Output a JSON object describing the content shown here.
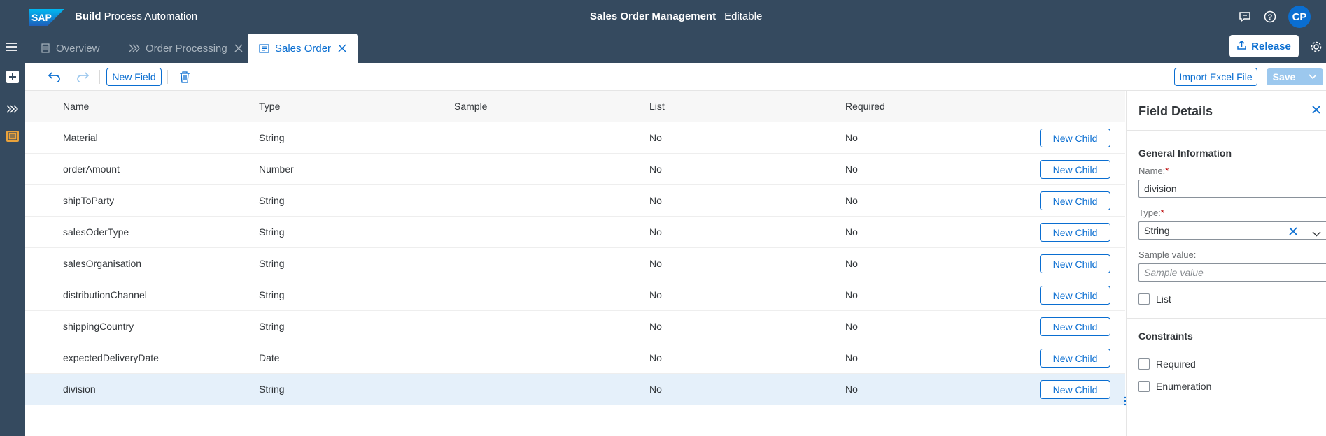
{
  "shell": {
    "logo_text": "SAP",
    "product_bold": "Build",
    "product_rest": "Process Automation",
    "project_name": "Sales Order Management",
    "project_status": "Editable",
    "avatar_initials": "CP"
  },
  "tabs": [
    {
      "label": "Overview",
      "icon": "overview-icon",
      "closable": false,
      "active": false
    },
    {
      "label": "Order Processing",
      "icon": "process-icon",
      "closable": true,
      "active": false
    },
    {
      "label": "Sales Order",
      "icon": "data-type-icon",
      "closable": true,
      "active": true
    }
  ],
  "header_actions": {
    "release_label": "Release"
  },
  "toolbar": {
    "new_field_label": "New Field",
    "import_label": "Import Excel File",
    "save_label": "Save"
  },
  "table": {
    "columns": [
      "Name",
      "Type",
      "Sample",
      "List",
      "Required"
    ],
    "new_child_label": "New Child",
    "rows": [
      {
        "name": "Material",
        "type": "String",
        "sample": "",
        "list": "No",
        "required": "No"
      },
      {
        "name": "orderAmount",
        "type": "Number",
        "sample": "",
        "list": "No",
        "required": "No"
      },
      {
        "name": "shipToParty",
        "type": "String",
        "sample": "",
        "list": "No",
        "required": "No"
      },
      {
        "name": "salesOderType",
        "type": "String",
        "sample": "",
        "list": "No",
        "required": "No"
      },
      {
        "name": "salesOrganisation",
        "type": "String",
        "sample": "",
        "list": "No",
        "required": "No"
      },
      {
        "name": "distributionChannel",
        "type": "String",
        "sample": "",
        "list": "No",
        "required": "No"
      },
      {
        "name": "shippingCountry",
        "type": "String",
        "sample": "",
        "list": "No",
        "required": "No"
      },
      {
        "name": "expectedDeliveryDate",
        "type": "Date",
        "sample": "",
        "list": "No",
        "required": "No"
      },
      {
        "name": "division",
        "type": "String",
        "sample": "",
        "list": "No",
        "required": "No",
        "selected": true
      }
    ]
  },
  "details": {
    "title": "Field Details",
    "general_title": "General Information",
    "name_label": "Name:",
    "name_value": "division",
    "type_label": "Type:",
    "type_value": "String",
    "sample_label": "Sample value:",
    "sample_placeholder": "Sample value",
    "list_label": "List",
    "constraints_title": "Constraints",
    "required_label": "Required",
    "enumeration_label": "Enumeration",
    "required_marker": "*"
  },
  "colors": {
    "shell": "#354a5f",
    "accent": "#0a6ed1",
    "selected_row": "#e5f0fa"
  }
}
